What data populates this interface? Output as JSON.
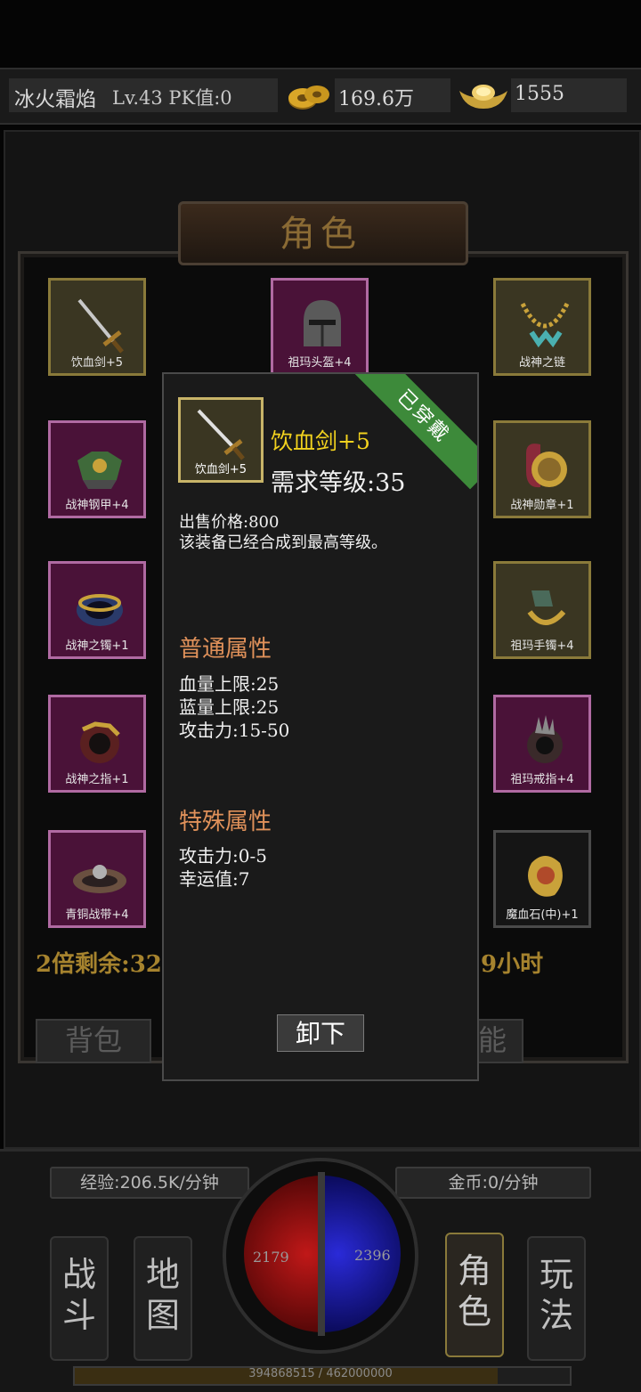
{
  "topbar": {
    "player_name": "冰火霜焰",
    "player_info": "Lv.43 PK值:0",
    "gold": "169.6万",
    "ingot": "1555",
    "gold_icon": "coin-stack-icon",
    "ingot_icon": "gold-ingot-icon"
  },
  "panel": {
    "title": "角色",
    "left_text": "2倍剩余:32",
    "right_text": "9小时",
    "tab_bag": "背包",
    "tab_skill_partial": "能"
  },
  "slots": [
    {
      "label": "饮血剑+5",
      "frame": "gold",
      "icon": "sword-icon"
    },
    {
      "label": "祖玛头盔+4",
      "frame": "purple",
      "icon": "helmet-icon"
    },
    {
      "label": "战神之链",
      "frame": "gold",
      "icon": "necklace-icon"
    },
    {
      "label": "战神钢甲+4",
      "frame": "purple",
      "icon": "armor-icon"
    },
    {
      "label": "战神勋章+1",
      "frame": "gold",
      "icon": "medal-icon"
    },
    {
      "label": "战神之镯+1",
      "frame": "purple",
      "icon": "bracelet-icon"
    },
    {
      "label": "祖玛手镯+4",
      "frame": "gold",
      "icon": "bracelet-icon"
    },
    {
      "label": "战神之指+1",
      "frame": "purple",
      "icon": "ring-icon"
    },
    {
      "label": "祖玛戒指+4",
      "frame": "purple",
      "icon": "ring-icon"
    },
    {
      "label": "青铜战带+4",
      "frame": "purple",
      "icon": "belt-icon"
    },
    {
      "label": "魔血石(中)+1",
      "frame": "dark",
      "icon": "gem-icon"
    }
  ],
  "popup": {
    "ribbon": "已穿戴",
    "item_label": "饮血剑+5",
    "item_name": "饮血剑+5",
    "required_level": "需求等级:35",
    "sell_price": "出售价格:800",
    "note": "该装备已经合成到最高等级。",
    "normal_title": "普通属性",
    "normal_attrs": [
      "血量上限:25",
      "蓝量上限:25",
      "攻击力:15-50"
    ],
    "special_title": "特殊属性",
    "special_attrs": [
      "攻击力:0-5",
      "幸运值:7"
    ],
    "unequip": "卸下"
  },
  "hud": {
    "exp_rate": "经验:206.5K/分钟",
    "gold_rate": "金币:0/分钟",
    "hp": "2179",
    "mp": "2396",
    "nav": [
      "战\n斗",
      "地\n图",
      "角\n色",
      "玩\n法"
    ],
    "xp_text": "394868515 / 462000000",
    "xp_fraction": 0.8547
  }
}
